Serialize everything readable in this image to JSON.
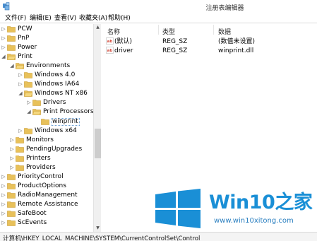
{
  "window": {
    "title": "注册表编辑器"
  },
  "menu": [
    {
      "label": "文件(F)"
    },
    {
      "label": "编辑(E)"
    },
    {
      "label": "查看(V)"
    },
    {
      "label": "收藏夹(A)"
    },
    {
      "label": "帮助(H)"
    }
  ],
  "tree": [
    {
      "label": "PCW",
      "depth": 0,
      "expander": "collapsed"
    },
    {
      "label": "PnP",
      "depth": 0,
      "expander": "collapsed"
    },
    {
      "label": "Power",
      "depth": 0,
      "expander": "collapsed"
    },
    {
      "label": "Print",
      "depth": 0,
      "expander": "expanded"
    },
    {
      "label": "Environments",
      "depth": 1,
      "expander": "expanded"
    },
    {
      "label": "Windows 4.0",
      "depth": 2,
      "expander": "collapsed"
    },
    {
      "label": "Windows IA64",
      "depth": 2,
      "expander": "collapsed"
    },
    {
      "label": "Windows NT x86",
      "depth": 2,
      "expander": "expanded"
    },
    {
      "label": "Drivers",
      "depth": 3,
      "expander": "collapsed"
    },
    {
      "label": "Print Processors",
      "depth": 3,
      "expander": "expanded"
    },
    {
      "label": "winprint",
      "depth": 4,
      "expander": "none",
      "selected": true
    },
    {
      "label": "Windows x64",
      "depth": 2,
      "expander": "collapsed"
    },
    {
      "label": "Monitors",
      "depth": 1,
      "expander": "collapsed"
    },
    {
      "label": "PendingUpgrades",
      "depth": 1,
      "expander": "collapsed"
    },
    {
      "label": "Printers",
      "depth": 1,
      "expander": "collapsed"
    },
    {
      "label": "Providers",
      "depth": 1,
      "expander": "collapsed"
    },
    {
      "label": "PriorityControl",
      "depth": 0,
      "expander": "collapsed"
    },
    {
      "label": "ProductOptions",
      "depth": 0,
      "expander": "collapsed"
    },
    {
      "label": "RadioManagement",
      "depth": 0,
      "expander": "collapsed"
    },
    {
      "label": "Remote Assistance",
      "depth": 0,
      "expander": "collapsed"
    },
    {
      "label": "SafeBoot",
      "depth": 0,
      "expander": "collapsed"
    },
    {
      "label": "ScEvents",
      "depth": 0,
      "expander": "collapsed"
    }
  ],
  "list": {
    "headers": {
      "name": "名称",
      "type": "类型",
      "data": "数据"
    },
    "rows": [
      {
        "name": "(默认)",
        "type": "REG_SZ",
        "data": "(数值未设置)",
        "icon": "string-value-icon"
      },
      {
        "name": "driver",
        "type": "REG_SZ",
        "data": "winprint.dll",
        "icon": "string-value-icon"
      }
    ]
  },
  "status": {
    "path": "计算机\\HKEY_LOCAL_MACHINE\\SYSTEM\\CurrentControlSet\\Control"
  },
  "watermark": {
    "brand": "Win10",
    "brand_suffix": "之家",
    "url": "www.win10xitong.com",
    "colors": {
      "logo": "#1a8fd6",
      "text": "#1a8fd6"
    }
  },
  "colors": {
    "folder": "#e8c15a",
    "folder_dark": "#c99a2e",
    "selection_border": "#6a9fd4",
    "value_icon": "#d44a3a"
  }
}
